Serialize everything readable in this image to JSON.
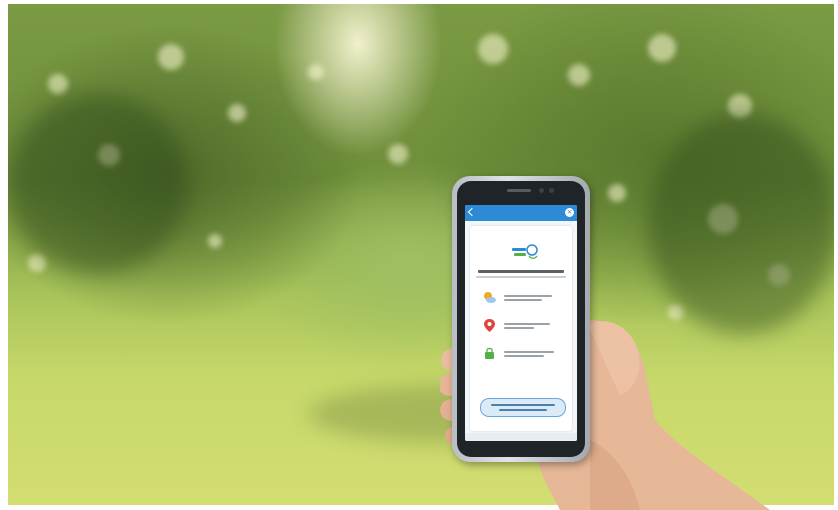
{
  "scene": {
    "subject": "smartphone-held-in-hand",
    "background": "blurred-orchard",
    "accent_color": "#2d8ad6",
    "foliage_color": "#5a7a2e",
    "grass_color": "#c7d86a"
  },
  "app_screen": {
    "icons": [
      "back-icon",
      "close-icon",
      "app-logo-icon",
      "weather-icon",
      "location-pin-icon",
      "lock-icon"
    ],
    "feature_count": 3
  }
}
